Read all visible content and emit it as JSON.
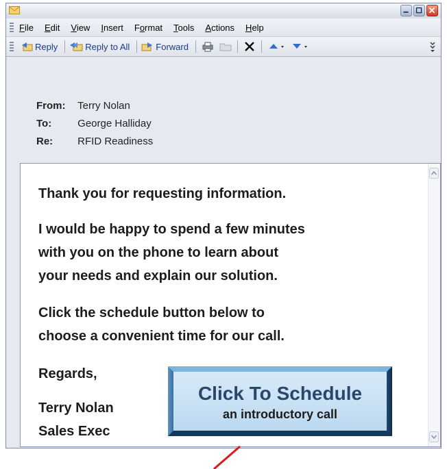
{
  "menu": [
    {
      "accel": "F",
      "rest": "ile"
    },
    {
      "accel": "E",
      "rest": "dit"
    },
    {
      "accel": "V",
      "rest": "iew"
    },
    {
      "accel": "I",
      "rest": "nsert"
    },
    {
      "pre": "F",
      "accel": "o",
      "rest": "rmat"
    },
    {
      "accel": "T",
      "rest": "ools"
    },
    {
      "accel": "A",
      "rest": "ctions"
    },
    {
      "accel": "H",
      "rest": "elp"
    }
  ],
  "toolbar": {
    "reply": "Reply",
    "reply_all": "Reply to All",
    "forward": "Forward"
  },
  "header": {
    "from_label": "From:",
    "from_value": "Terry Nolan",
    "to_label": "To:",
    "to_value": "George Halliday",
    "re_label": "Re:",
    "re_value": "RFID Readiness"
  },
  "message": {
    "line1": "Thank you for requesting information.",
    "para2_l1": "I would be happy to spend a few minutes",
    "para2_l2": "with you on the phone to learn about",
    "para2_l3": "your needs and explain our solution.",
    "para3_l1": "Click the schedule button below to",
    "para3_l2": "choose a convenient time for our call.",
    "regards": "Regards,",
    "sig_name": "Terry Nolan",
    "sig_title": "Sales Exec"
  },
  "schedule_button": {
    "main": "Click To Schedule",
    "sub": "an introductory call"
  },
  "colors": {
    "pointer_line": "#e01818",
    "button_face": "#c9e2f5"
  }
}
